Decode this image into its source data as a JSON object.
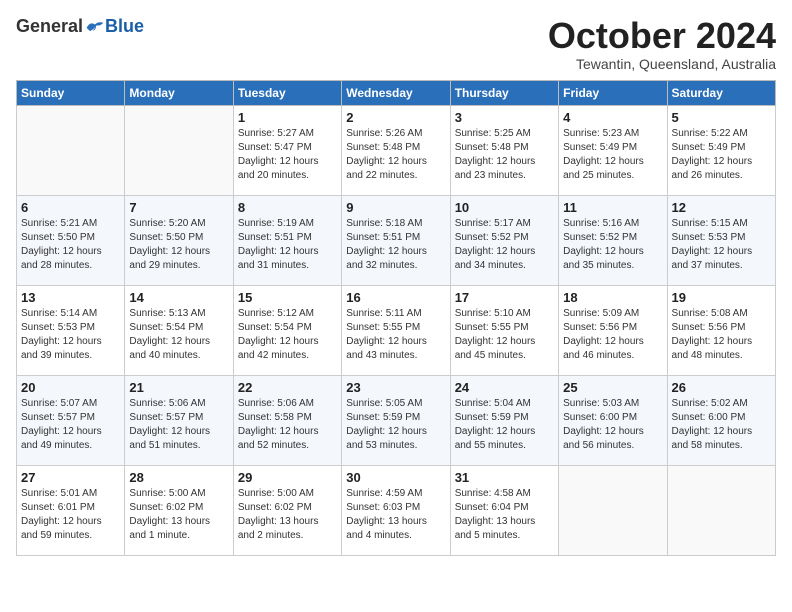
{
  "header": {
    "logo_general": "General",
    "logo_blue": "Blue",
    "month_title": "October 2024",
    "location": "Tewantin, Queensland, Australia"
  },
  "calendar": {
    "days_of_week": [
      "Sunday",
      "Monday",
      "Tuesday",
      "Wednesday",
      "Thursday",
      "Friday",
      "Saturday"
    ],
    "weeks": [
      [
        {
          "day": "",
          "info": ""
        },
        {
          "day": "",
          "info": ""
        },
        {
          "day": "1",
          "info": "Sunrise: 5:27 AM\nSunset: 5:47 PM\nDaylight: 12 hours\nand 20 minutes."
        },
        {
          "day": "2",
          "info": "Sunrise: 5:26 AM\nSunset: 5:48 PM\nDaylight: 12 hours\nand 22 minutes."
        },
        {
          "day": "3",
          "info": "Sunrise: 5:25 AM\nSunset: 5:48 PM\nDaylight: 12 hours\nand 23 minutes."
        },
        {
          "day": "4",
          "info": "Sunrise: 5:23 AM\nSunset: 5:49 PM\nDaylight: 12 hours\nand 25 minutes."
        },
        {
          "day": "5",
          "info": "Sunrise: 5:22 AM\nSunset: 5:49 PM\nDaylight: 12 hours\nand 26 minutes."
        }
      ],
      [
        {
          "day": "6",
          "info": "Sunrise: 5:21 AM\nSunset: 5:50 PM\nDaylight: 12 hours\nand 28 minutes."
        },
        {
          "day": "7",
          "info": "Sunrise: 5:20 AM\nSunset: 5:50 PM\nDaylight: 12 hours\nand 29 minutes."
        },
        {
          "day": "8",
          "info": "Sunrise: 5:19 AM\nSunset: 5:51 PM\nDaylight: 12 hours\nand 31 minutes."
        },
        {
          "day": "9",
          "info": "Sunrise: 5:18 AM\nSunset: 5:51 PM\nDaylight: 12 hours\nand 32 minutes."
        },
        {
          "day": "10",
          "info": "Sunrise: 5:17 AM\nSunset: 5:52 PM\nDaylight: 12 hours\nand 34 minutes."
        },
        {
          "day": "11",
          "info": "Sunrise: 5:16 AM\nSunset: 5:52 PM\nDaylight: 12 hours\nand 35 minutes."
        },
        {
          "day": "12",
          "info": "Sunrise: 5:15 AM\nSunset: 5:53 PM\nDaylight: 12 hours\nand 37 minutes."
        }
      ],
      [
        {
          "day": "13",
          "info": "Sunrise: 5:14 AM\nSunset: 5:53 PM\nDaylight: 12 hours\nand 39 minutes."
        },
        {
          "day": "14",
          "info": "Sunrise: 5:13 AM\nSunset: 5:54 PM\nDaylight: 12 hours\nand 40 minutes."
        },
        {
          "day": "15",
          "info": "Sunrise: 5:12 AM\nSunset: 5:54 PM\nDaylight: 12 hours\nand 42 minutes."
        },
        {
          "day": "16",
          "info": "Sunrise: 5:11 AM\nSunset: 5:55 PM\nDaylight: 12 hours\nand 43 minutes."
        },
        {
          "day": "17",
          "info": "Sunrise: 5:10 AM\nSunset: 5:55 PM\nDaylight: 12 hours\nand 45 minutes."
        },
        {
          "day": "18",
          "info": "Sunrise: 5:09 AM\nSunset: 5:56 PM\nDaylight: 12 hours\nand 46 minutes."
        },
        {
          "day": "19",
          "info": "Sunrise: 5:08 AM\nSunset: 5:56 PM\nDaylight: 12 hours\nand 48 minutes."
        }
      ],
      [
        {
          "day": "20",
          "info": "Sunrise: 5:07 AM\nSunset: 5:57 PM\nDaylight: 12 hours\nand 49 minutes."
        },
        {
          "day": "21",
          "info": "Sunrise: 5:06 AM\nSunset: 5:57 PM\nDaylight: 12 hours\nand 51 minutes."
        },
        {
          "day": "22",
          "info": "Sunrise: 5:06 AM\nSunset: 5:58 PM\nDaylight: 12 hours\nand 52 minutes."
        },
        {
          "day": "23",
          "info": "Sunrise: 5:05 AM\nSunset: 5:59 PM\nDaylight: 12 hours\nand 53 minutes."
        },
        {
          "day": "24",
          "info": "Sunrise: 5:04 AM\nSunset: 5:59 PM\nDaylight: 12 hours\nand 55 minutes."
        },
        {
          "day": "25",
          "info": "Sunrise: 5:03 AM\nSunset: 6:00 PM\nDaylight: 12 hours\nand 56 minutes."
        },
        {
          "day": "26",
          "info": "Sunrise: 5:02 AM\nSunset: 6:00 PM\nDaylight: 12 hours\nand 58 minutes."
        }
      ],
      [
        {
          "day": "27",
          "info": "Sunrise: 5:01 AM\nSunset: 6:01 PM\nDaylight: 12 hours\nand 59 minutes."
        },
        {
          "day": "28",
          "info": "Sunrise: 5:00 AM\nSunset: 6:02 PM\nDaylight: 13 hours\nand 1 minute."
        },
        {
          "day": "29",
          "info": "Sunrise: 5:00 AM\nSunset: 6:02 PM\nDaylight: 13 hours\nand 2 minutes."
        },
        {
          "day": "30",
          "info": "Sunrise: 4:59 AM\nSunset: 6:03 PM\nDaylight: 13 hours\nand 4 minutes."
        },
        {
          "day": "31",
          "info": "Sunrise: 4:58 AM\nSunset: 6:04 PM\nDaylight: 13 hours\nand 5 minutes."
        },
        {
          "day": "",
          "info": ""
        },
        {
          "day": "",
          "info": ""
        }
      ]
    ]
  }
}
